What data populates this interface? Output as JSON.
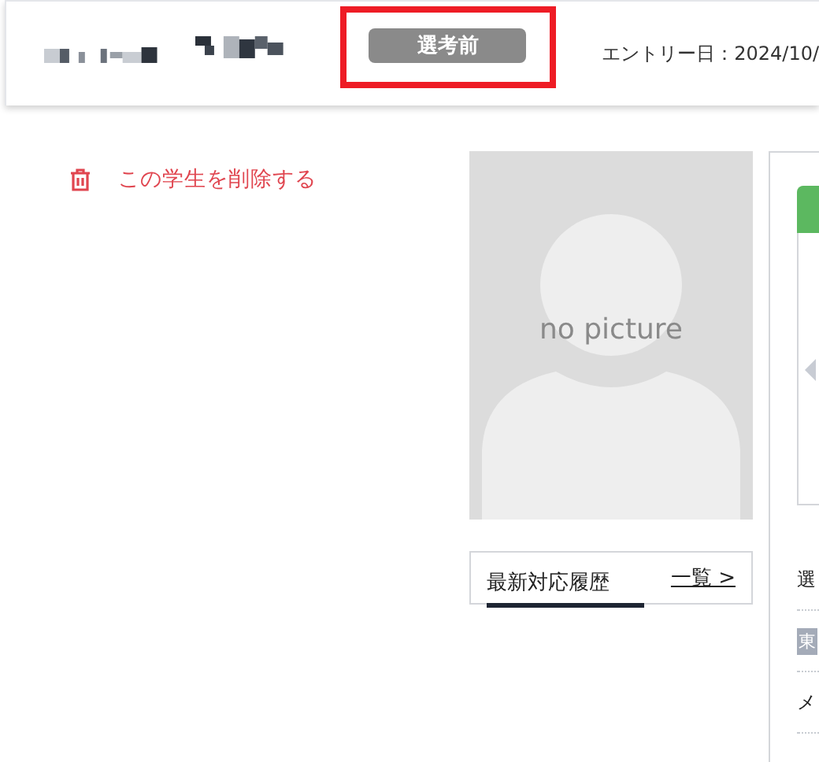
{
  "header": {
    "status_badge": "選考前",
    "entry_date": "エントリー日：2024/10/"
  },
  "delete_link": "この学生を削除する",
  "photo": {
    "placeholder": "no picture"
  },
  "history_tabs": {
    "title": "最新対応履歴",
    "link": "一覧 >"
  },
  "side_panel": {
    "rows": [
      {
        "kind": "label",
        "text": "選"
      },
      {
        "kind": "badge",
        "text": "東"
      },
      {
        "kind": "label",
        "text": "メ"
      }
    ]
  }
}
